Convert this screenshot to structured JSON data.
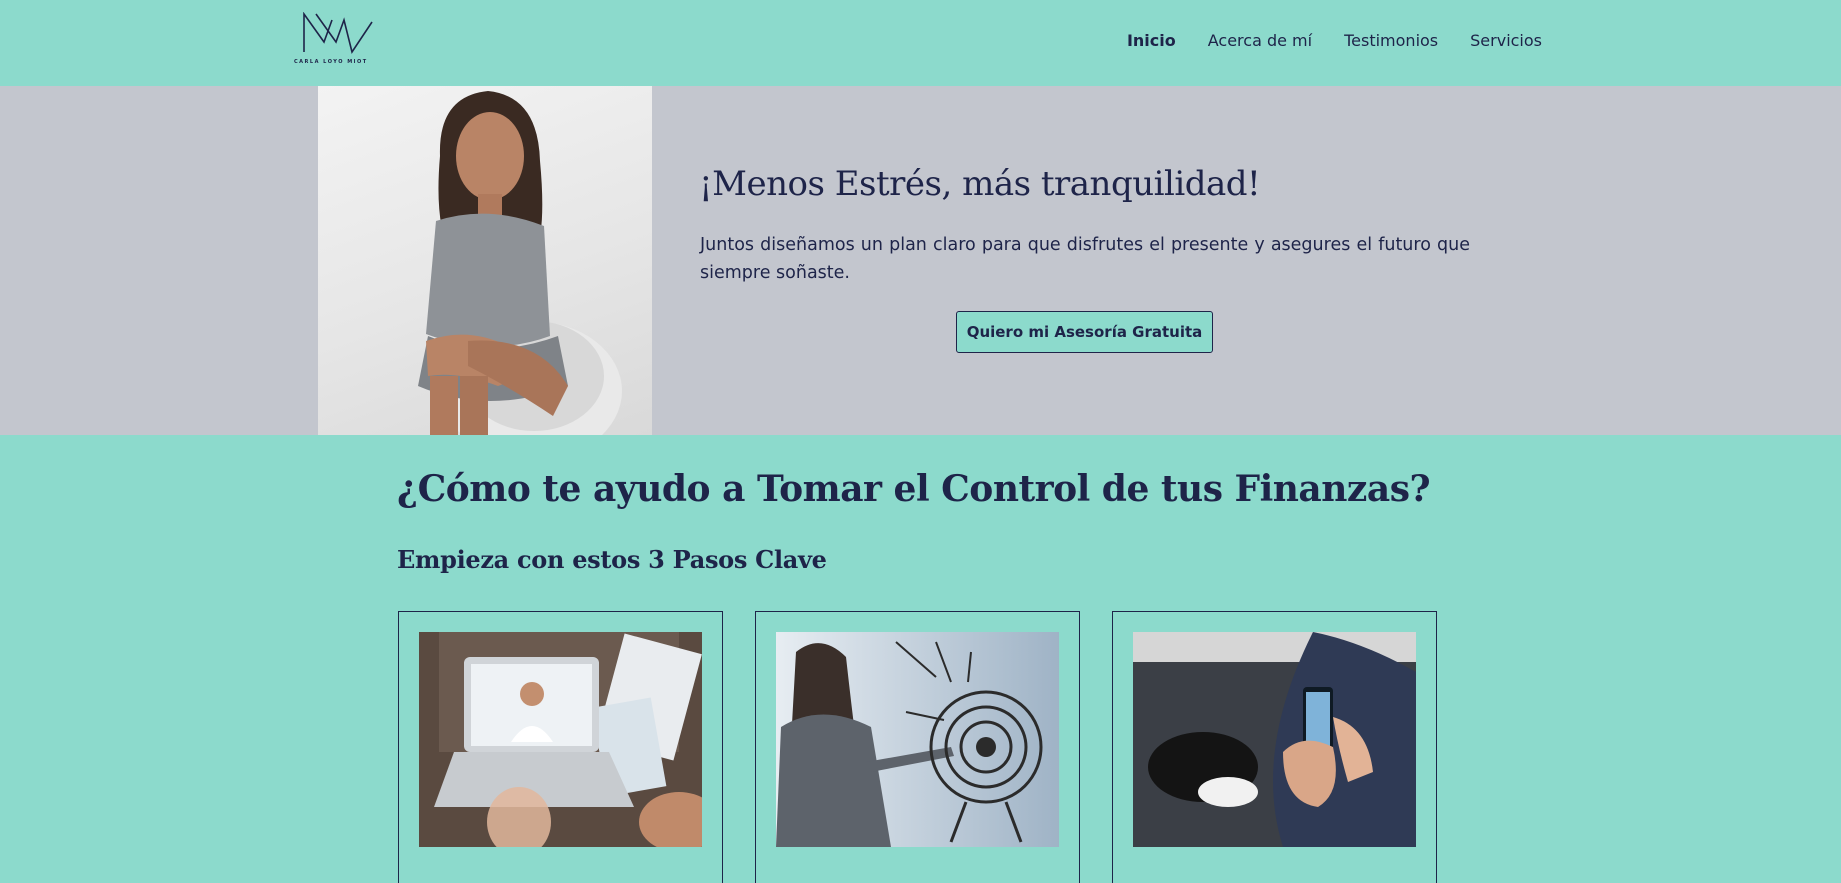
{
  "header": {
    "logo_text": "CARLA LOYO MIOT",
    "nav": [
      {
        "label": "Inicio",
        "active": true
      },
      {
        "label": "Acerca de mí",
        "active": false
      },
      {
        "label": "Testimonios",
        "active": false
      },
      {
        "label": "Servicios",
        "active": false
      }
    ]
  },
  "hero": {
    "title": "¡Menos Estrés, más tranquilidad!",
    "text": "Juntos diseñamos un plan claro para que disfrutes el presente y asegures el futuro que siempre soñaste.",
    "cta_label": "Quiero mi Asesoría Gratuita"
  },
  "section": {
    "title": "¿Cómo te ayudo a Tomar el Control de tus Finanzas?",
    "subtitle": "Empieza con estos 3 Pasos Clave"
  },
  "colors": {
    "background": "#8cdacc",
    "hero_background": "#c3c6ce",
    "text": "#1e2449"
  }
}
